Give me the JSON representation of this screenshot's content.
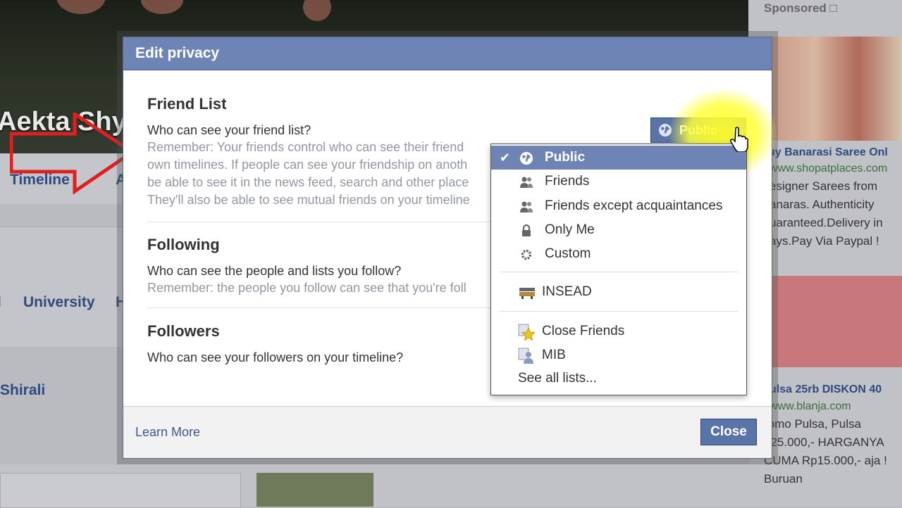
{
  "background": {
    "profile_name": "Aekta Shy",
    "nav_timeline": "Timeline",
    "nav_partial": "A",
    "work_partial": "l",
    "education": "University",
    "education_partial": "H",
    "friend_partial": "Shirali"
  },
  "ads": {
    "sponsored": "Sponsored",
    "ad1_title": "uy Banarasi Saree Onl",
    "ad1_url": "www.shopatplaces.com",
    "ad1_text": [
      "esigner Sarees from",
      "anaras. Authenticity",
      "uaranteed.Delivery in",
      "ays.Pay Via Paypal !"
    ],
    "ad2_title": "ulsa 25rb DISKON 40",
    "ad2_url": "www.blanja.com",
    "ad2_text": [
      "romo Pulsa, Pulsa",
      "p25.000,- HARGANYA",
      "CUMA Rp15.000,- aja !",
      "Buruan"
    ]
  },
  "dialog": {
    "title": "Edit privacy",
    "friend_list": {
      "title": "Friend List",
      "question": "Who can see your friend list?",
      "note": [
        "Remember: Your friends control who can see their friend",
        "own timelines. If people can see your friendship on anoth",
        "be able to see it in the news feed, search and other place",
        "They'll also be able to see mutual friends on your timeline"
      ],
      "privacy_value": "Public"
    },
    "following": {
      "title": "Following",
      "question": "Who can see the people and lists you follow?",
      "note": "Remember: the people you follow can see that you're foll"
    },
    "followers": {
      "title": "Followers",
      "question": "Who can see your followers on your timeline?"
    },
    "learn_more": "Learn More",
    "close": "Close"
  },
  "menu": {
    "items": [
      {
        "label": "Public",
        "icon": "globe-icon",
        "selected": true
      },
      {
        "label": "Friends",
        "icon": "friends-icon"
      },
      {
        "label": "Friends except acquaintances",
        "icon": "friends-icon"
      },
      {
        "label": "Only Me",
        "icon": "lock-icon"
      },
      {
        "label": "Custom",
        "icon": "gear-icon"
      },
      {
        "label": "INSEAD",
        "icon": "school-icon"
      },
      {
        "label": "Close Friends",
        "icon": "star-icon"
      },
      {
        "label": "MIB",
        "icon": "person-list-icon"
      },
      {
        "label": "See all lists...",
        "icon": ""
      }
    ]
  },
  "colors": {
    "header": "#6d84b4",
    "button": "#5b74a8",
    "link": "#3b5998",
    "arrow": "#e0201e"
  }
}
